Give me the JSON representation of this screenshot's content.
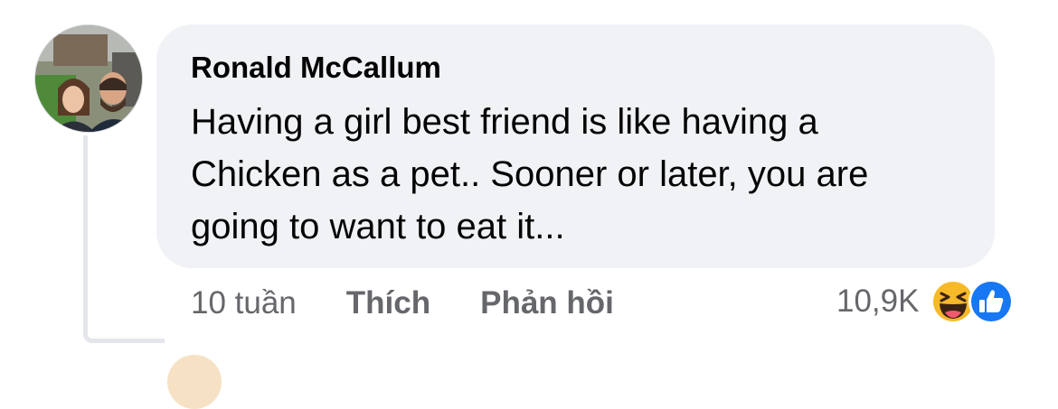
{
  "comment": {
    "author": "Ronald McCallum",
    "text_lines": [
      "Having a girl best friend is like having a",
      "Chicken as a pet.. Sooner or later, you are",
      "going to want to eat it..."
    ],
    "timestamp": "10 tuần",
    "like_label": "Thích",
    "reply_label": "Phản hồi",
    "reaction_count": "10,9K",
    "reaction_icons": [
      "haha-icon",
      "like-icon"
    ]
  },
  "colors": {
    "bubble": "#f0f2f5",
    "secondary_text": "#65676b",
    "like_blue": "#1877f2",
    "haha_yellow": "#f7b928"
  }
}
